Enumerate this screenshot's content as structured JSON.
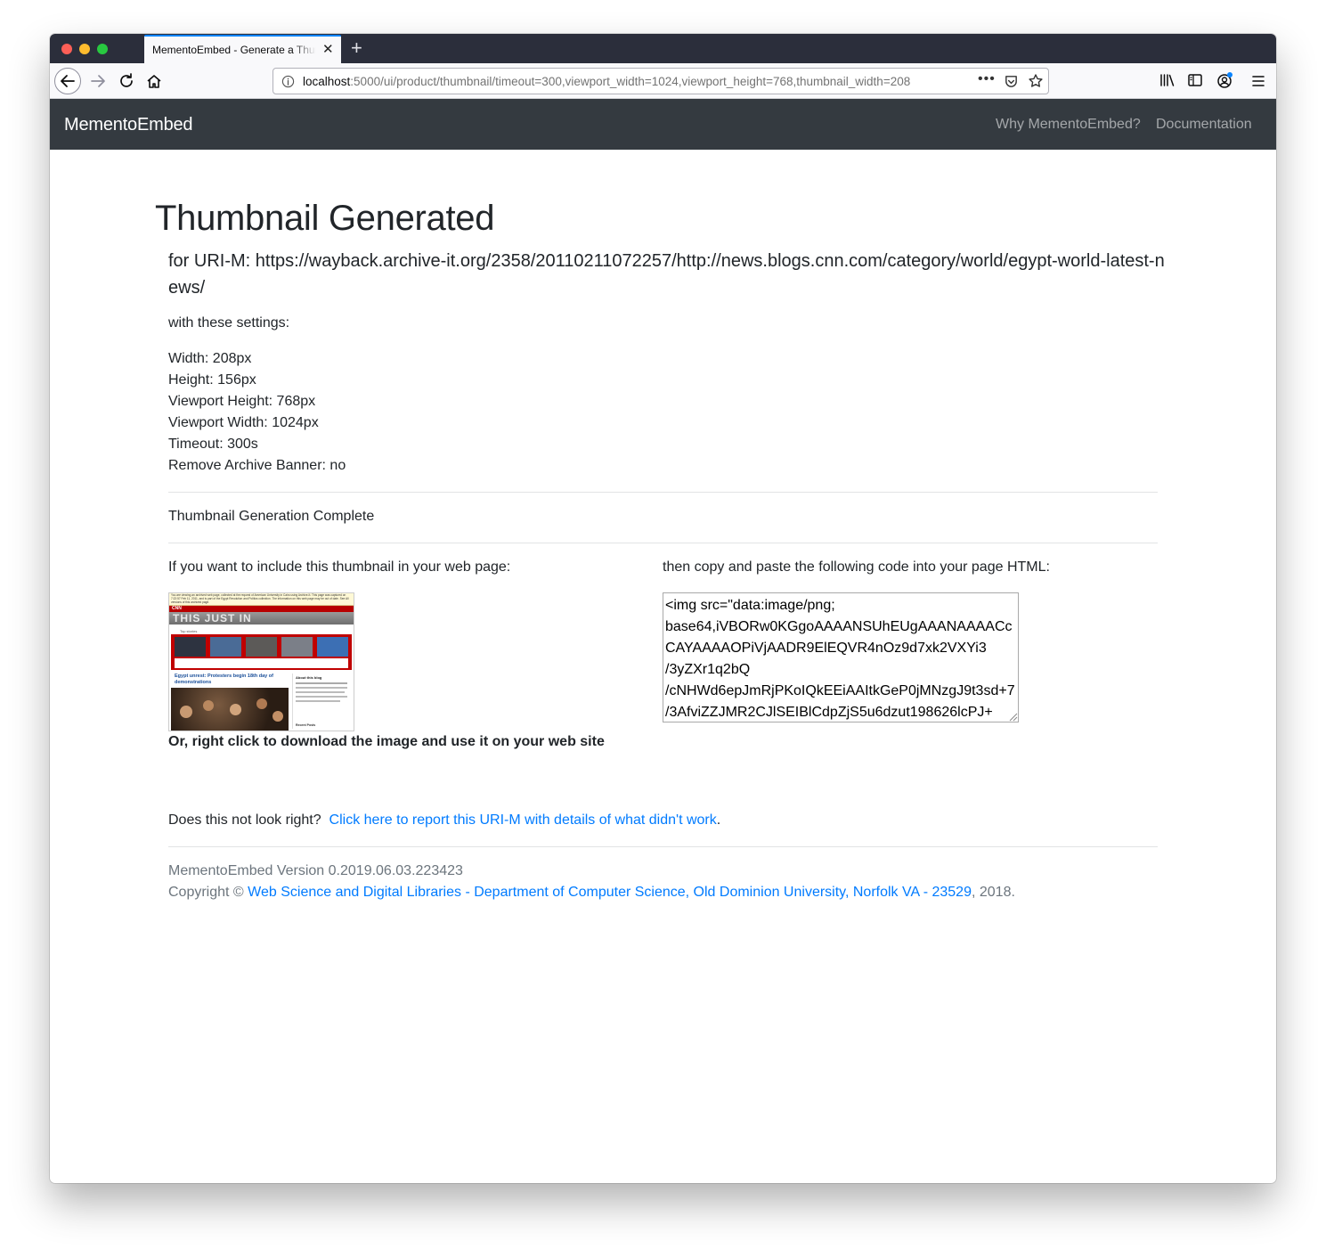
{
  "browser": {
    "tab_title": "MementoEmbed - Generate a Thumbnail",
    "url_host": "localhost",
    "url_rest": ":5000/ui/product/thumbnail/timeout=300,viewport_width=1024,viewport_height=768,thumbnail_width=208"
  },
  "navbar": {
    "brand": "MementoEmbed",
    "links": [
      "Why MementoEmbed?",
      "Documentation"
    ]
  },
  "page": {
    "title": "Thumbnail Generated",
    "uri_line": "for URI-M: https://wayback.archive-it.org/2358/20110211072257/http://news.blogs.cnn.com/category/world/egypt-world-latest-news/",
    "settings_intro": "with these settings:",
    "settings": [
      "Width: 208px",
      "Height: 156px",
      "Viewport Height: 768px",
      "Viewport Width: 1024px",
      "Timeout: 300s",
      "Remove Archive Banner: no"
    ],
    "status": "Thumbnail Generation Complete",
    "include_text": "If you want to include this thumbnail in your web page:",
    "copy_text": "then copy and paste the following code into your page HTML:",
    "code": "<img src=\"data:image/png;\nbase64,iVBORw0KGgoAAAANSUhEUgAAANAAAACcCAYAAAAOPiVjAADR9ElEQVR4nOz9d7xk2VXYi3\n/3yZXr1q2bQ\n/cNHWd6epJmRjPKoIQkEEiAAItkGeP0jMNzgJ9t3sd+7\n/3AfviZZJMR2CJlSEIBlCdpZjS5u6dzut198626lcPJ+",
    "download_text": "Or, right click to download the image and use it on your web site",
    "report_prompt": "Does this not look right?",
    "report_link": "Click here to report this URI-M with details of what didn't work",
    "report_period": "."
  },
  "thumbnail": {
    "banner": "You are viewing an archived web page, collected at the request of American University in Cairo using Archive-It. This page was captured on 7:22:57 Feb 11, 2011, and is part of the Egypt Revolution and Politics collection. The information on this web page may be out of date. See All versions of this archived page.",
    "logo": "CNN",
    "masthead": "THIS JUST IN",
    "section": "Top stories",
    "headline": "Egypt unrest: Protesters begin 18th day of demonstrations",
    "sidebar_title": "About this blog",
    "sidebar_bottom": "Recent Posts"
  },
  "footer": {
    "version": "MementoEmbed Version 0.2019.06.03.223423",
    "copyright_prefix": "Copyright ©",
    "org_link": "Web Science and Digital Libraries - Department of Computer Science, Old Dominion University, Norfolk VA - 23529",
    "copyright_suffix": ", 2018."
  }
}
